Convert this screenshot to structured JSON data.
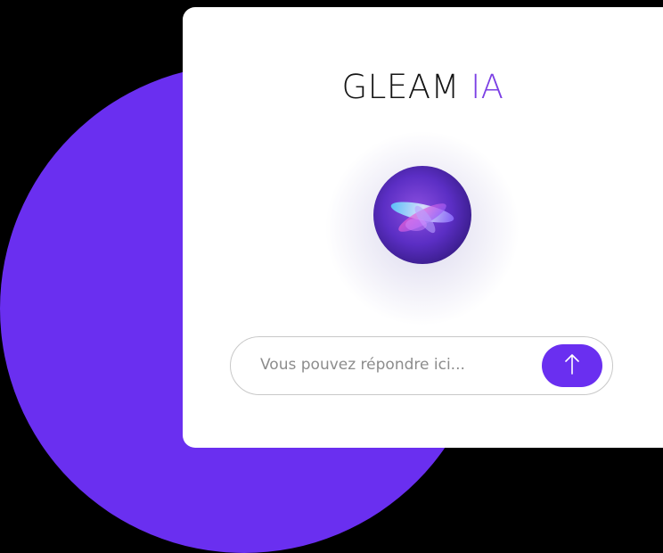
{
  "app": {
    "title_main": "GLEAM",
    "title_accent": "IA"
  },
  "chat": {
    "input_placeholder": "Vous pouvez répondre ici...",
    "send_icon": "arrow-up-icon"
  },
  "colors": {
    "accent": "#6a2ff0",
    "title_accent": "#7b3fe4",
    "background": "#000000",
    "card": "#ffffff"
  }
}
